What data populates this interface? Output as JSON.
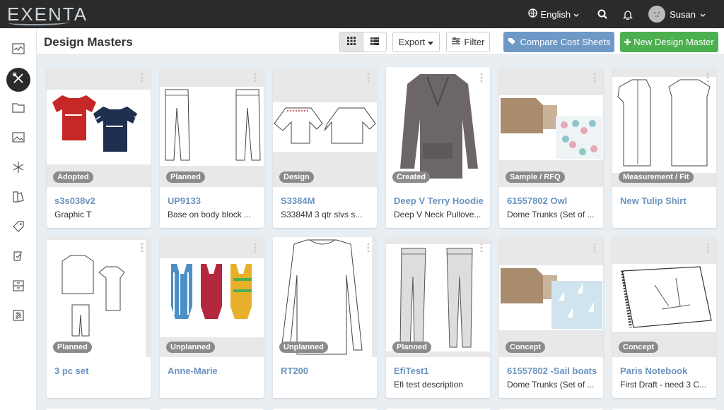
{
  "app": {
    "logo_text": "EXENTA"
  },
  "topbar": {
    "language": "English",
    "user_name": "Susan"
  },
  "header": {
    "title": "Design Masters",
    "export_label": "Export",
    "filter_label": "Filter",
    "compare_label": "Compare Cost Sheets",
    "new_label": "New Design Master"
  },
  "sidebar": {
    "items": [
      "dashboard-icon",
      "design-tools-icon",
      "folder-icon",
      "image-icon",
      "snowflake-icon",
      "swatch-icon",
      "tag-icon",
      "checklist-icon",
      "archive-icon",
      "sliders-icon"
    ]
  },
  "cards": [
    {
      "status": "Adopted",
      "title": "s3s038v2",
      "desc": "Graphic T"
    },
    {
      "status": "Planned",
      "title": "UP9133",
      "desc": "Base on body block ..."
    },
    {
      "status": "Design",
      "title": "S3384M",
      "desc": "S3384M 3 qtr slvs s..."
    },
    {
      "status": "Created",
      "title": "Deep V Terry Hoodie",
      "desc": "Deep V Neck Pullove..."
    },
    {
      "status": "Sample / RFQ",
      "title": "61557802 Owl",
      "desc": "Dome Trunks (Set of ..."
    },
    {
      "status": "Measurement / Fit",
      "title": "New Tulip Shirt",
      "desc": ""
    },
    {
      "status": "Planned",
      "title": "3 pc set",
      "desc": ""
    },
    {
      "status": "Unplanned",
      "title": "Anne-Marie",
      "desc": ""
    },
    {
      "status": "Unplanned",
      "title": "RT200",
      "desc": ""
    },
    {
      "status": "Planned",
      "title": "EfiTest1",
      "desc": "Efi test description"
    },
    {
      "status": "Concept",
      "title": "61557802 -Sail boats",
      "desc": "Dome Trunks (Set of ..."
    },
    {
      "status": "Concept",
      "title": "Paris Notebook",
      "desc": "First Draft - need 3 C..."
    }
  ],
  "colors": {
    "accent": "#6b93bf",
    "compare": "#6e99c7",
    "new": "#4caf50",
    "topbar": "#2b2b2b"
  }
}
